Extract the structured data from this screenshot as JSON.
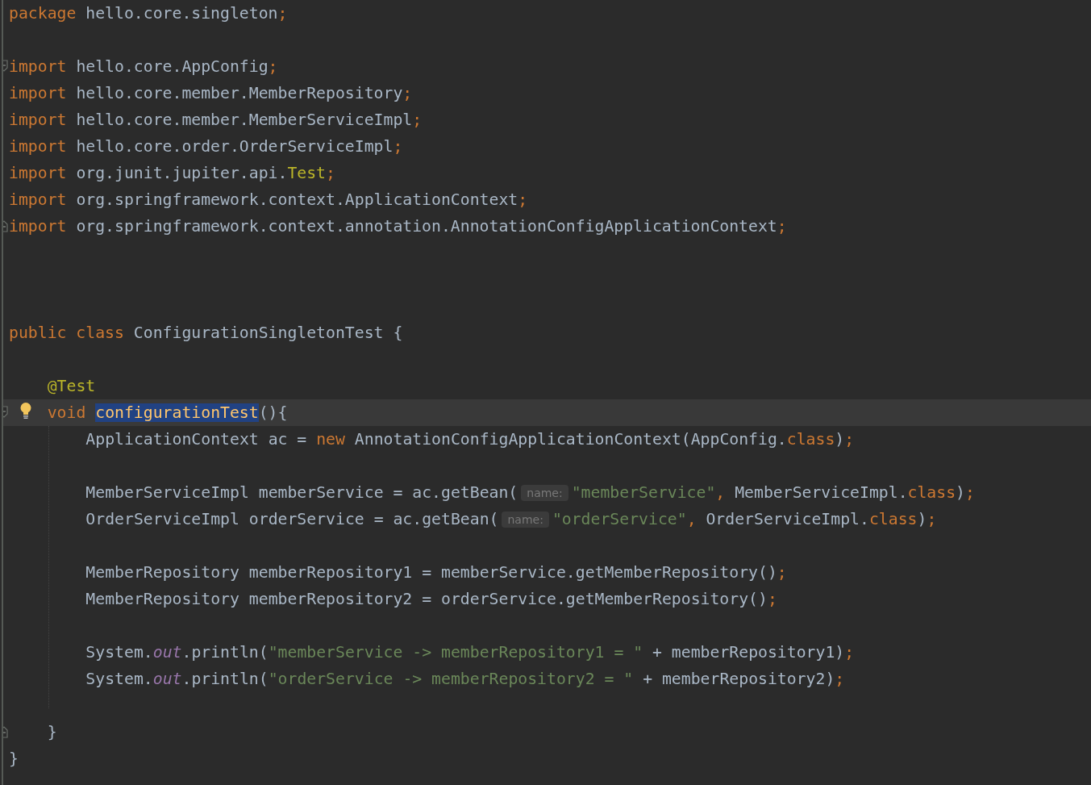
{
  "editor": {
    "lines": [
      {
        "segments": [
          {
            "kind": "code",
            "tokens": [
              {
                "text": "package",
                "kind": "kw"
              },
              {
                "text": " hello.core.singleton",
                "kind": "id"
              },
              {
                "text": ";",
                "kind": "kw"
              }
            ]
          }
        ]
      },
      {
        "gap_before": true,
        "fold_start": true,
        "segments": [
          {
            "kind": "code",
            "tokens": [
              {
                "text": "import",
                "kind": "kw"
              },
              {
                "text": " hello.core.AppConfig",
                "kind": "id"
              },
              {
                "text": ";",
                "kind": "kw"
              }
            ]
          }
        ]
      },
      {
        "segments": [
          {
            "kind": "code",
            "tokens": [
              {
                "text": "import",
                "kind": "kw"
              },
              {
                "text": " hello.core.member.MemberRepository",
                "kind": "id"
              },
              {
                "text": ";",
                "kind": "kw"
              }
            ]
          }
        ]
      },
      {
        "segments": [
          {
            "kind": "code",
            "tokens": [
              {
                "text": "import",
                "kind": "kw"
              },
              {
                "text": " hello.core.member.MemberServiceImpl",
                "kind": "id"
              },
              {
                "text": ";",
                "kind": "kw"
              }
            ]
          }
        ]
      },
      {
        "segments": [
          {
            "kind": "code",
            "tokens": [
              {
                "text": "import",
                "kind": "kw"
              },
              {
                "text": " hello.core.order.OrderServiceImpl",
                "kind": "id"
              },
              {
                "text": ";",
                "kind": "kw"
              }
            ]
          }
        ]
      },
      {
        "segments": [
          {
            "kind": "code",
            "tokens": [
              {
                "text": "import",
                "kind": "kw"
              },
              {
                "text": " org.junit.jupiter.api.",
                "kind": "id"
              },
              {
                "text": "Test",
                "kind": "ann"
              },
              {
                "text": ";",
                "kind": "kw"
              }
            ]
          }
        ]
      },
      {
        "segments": [
          {
            "kind": "code",
            "tokens": [
              {
                "text": "import",
                "kind": "kw"
              },
              {
                "text": " org.springframework.context.ApplicationContext",
                "kind": "id"
              },
              {
                "text": ";",
                "kind": "kw"
              }
            ]
          }
        ]
      },
      {
        "fold_end": true,
        "segments": [
          {
            "kind": "code",
            "tokens": [
              {
                "text": "import",
                "kind": "kw"
              },
              {
                "text": " org.springframework.context.annotation.AnnotationConfigApplicationContext",
                "kind": "id"
              },
              {
                "text": ";",
                "kind": "kw"
              }
            ]
          }
        ]
      },
      {
        "gap_before": true,
        "wide_gap": true,
        "segments": [
          {
            "kind": "code",
            "tokens": [
              {
                "text": "public class",
                "kind": "kw"
              },
              {
                "text": " ConfigurationSingletonTest {",
                "kind": "id"
              }
            ]
          }
        ],
        "children": [
          {
            "gap_before": true,
            "segments": [
              {
                "kind": "code",
                "tokens": [
                  {
                    "text": "@Test",
                    "kind": "ann"
                  }
                ]
              }
            ]
          },
          {
            "fold_start": true,
            "current": true,
            "bulb": true,
            "segments": [
              {
                "kind": "code",
                "tokens": [
                  {
                    "text": "void ",
                    "kind": "kw"
                  },
                  {
                    "text": "configurationTest",
                    "kind": "decl",
                    "selected": true
                  },
                  {
                    "text": "(){",
                    "kind": "id"
                  }
                ]
              }
            ],
            "children": [
              {
                "segments": [
                  {
                    "kind": "code",
                    "tokens": [
                      {
                        "text": "ApplicationContext ac = ",
                        "kind": "id"
                      },
                      {
                        "text": "new",
                        "kind": "kw"
                      },
                      {
                        "text": " AnnotationConfigApplicationContext(AppConfig.",
                        "kind": "id"
                      },
                      {
                        "text": "class",
                        "kind": "kw"
                      },
                      {
                        "text": ")",
                        "kind": "id"
                      },
                      {
                        "text": ";",
                        "kind": "kw"
                      }
                    ]
                  }
                ]
              },
              {
                "gap_before": true,
                "segments": [
                  {
                    "kind": "code",
                    "tokens": [
                      {
                        "text": "MemberServiceImpl memberService = ac.getBean(",
                        "kind": "id"
                      }
                    ]
                  },
                  {
                    "kind": "hint",
                    "text": "name:"
                  },
                  {
                    "kind": "code",
                    "tokens": [
                      {
                        "text": "\"memberService\"",
                        "kind": "str"
                      },
                      {
                        "text": ",",
                        "kind": "kw"
                      },
                      {
                        "text": " MemberServiceImpl.",
                        "kind": "id"
                      },
                      {
                        "text": "class",
                        "kind": "kw"
                      },
                      {
                        "text": ")",
                        "kind": "id"
                      },
                      {
                        "text": ";",
                        "kind": "kw"
                      }
                    ]
                  }
                ]
              },
              {
                "segments": [
                  {
                    "kind": "code",
                    "tokens": [
                      {
                        "text": "OrderServiceImpl orderService = ac.getBean(",
                        "kind": "id"
                      }
                    ]
                  },
                  {
                    "kind": "hint",
                    "text": "name:"
                  },
                  {
                    "kind": "code",
                    "tokens": [
                      {
                        "text": "\"orderService\"",
                        "kind": "str"
                      },
                      {
                        "text": ",",
                        "kind": "kw"
                      },
                      {
                        "text": " OrderServiceImpl.",
                        "kind": "id"
                      },
                      {
                        "text": "class",
                        "kind": "kw"
                      },
                      {
                        "text": ")",
                        "kind": "id"
                      },
                      {
                        "text": ";",
                        "kind": "kw"
                      }
                    ]
                  }
                ]
              },
              {
                "gap_before": true,
                "segments": [
                  {
                    "kind": "code",
                    "tokens": [
                      {
                        "text": "MemberRepository memberRepository1 = memberService.getMemberRepository()",
                        "kind": "id"
                      },
                      {
                        "text": ";",
                        "kind": "kw"
                      }
                    ]
                  }
                ]
              },
              {
                "segments": [
                  {
                    "kind": "code",
                    "tokens": [
                      {
                        "text": "MemberRepository memberRepository2 = orderService.getMemberRepository()",
                        "kind": "id"
                      },
                      {
                        "text": ";",
                        "kind": "kw"
                      }
                    ]
                  }
                ]
              },
              {
                "gap_before": true,
                "segments": [
                  {
                    "kind": "code",
                    "tokens": [
                      {
                        "text": "System.",
                        "kind": "id"
                      },
                      {
                        "text": "out",
                        "kind": "static"
                      },
                      {
                        "text": ".println(",
                        "kind": "id"
                      },
                      {
                        "text": "\"memberService -> memberRepository1 = \"",
                        "kind": "str"
                      },
                      {
                        "text": " + memberRepository1)",
                        "kind": "id"
                      },
                      {
                        "text": ";",
                        "kind": "kw"
                      }
                    ]
                  }
                ]
              },
              {
                "segments": [
                  {
                    "kind": "code",
                    "tokens": [
                      {
                        "text": "System.",
                        "kind": "id"
                      },
                      {
                        "text": "out",
                        "kind": "static"
                      },
                      {
                        "text": ".println(",
                        "kind": "id"
                      },
                      {
                        "text": "\"orderService -> memberRepository2 = \"",
                        "kind": "str"
                      },
                      {
                        "text": " + memberRepository2)",
                        "kind": "id"
                      },
                      {
                        "text": ";",
                        "kind": "kw"
                      }
                    ]
                  }
                ]
              }
            ]
          },
          {
            "gap_before": true,
            "fold_end": true,
            "segments": [
              {
                "kind": "code",
                "tokens": [
                  {
                    "text": "}",
                    "kind": "id"
                  }
                ]
              }
            ]
          }
        ]
      },
      {
        "segments": [
          {
            "kind": "code",
            "tokens": [
              {
                "text": "}",
                "kind": "id"
              }
            ]
          }
        ]
      }
    ]
  }
}
